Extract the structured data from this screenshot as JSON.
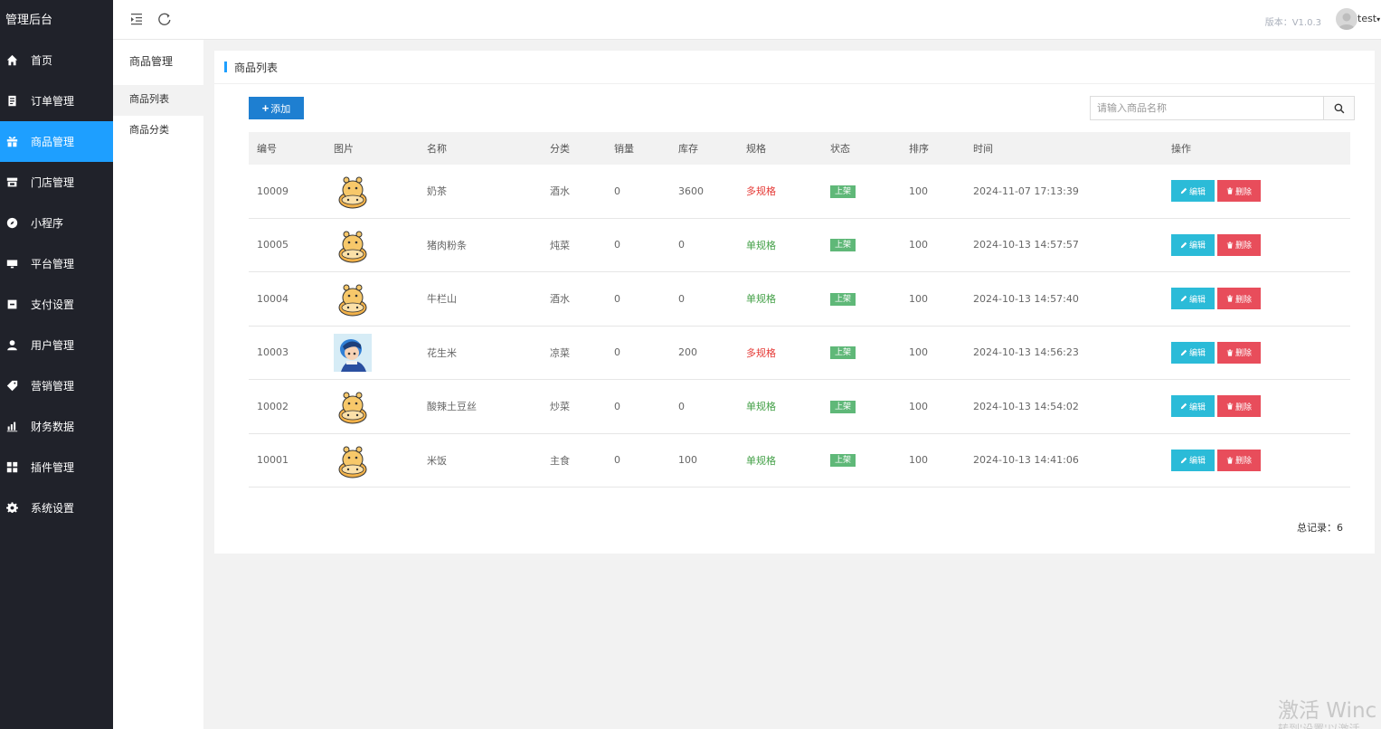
{
  "app": {
    "brand": "管理后台",
    "version": "版本：V1.0.3",
    "username": "test"
  },
  "sidebar": {
    "items": [
      {
        "label": "首页",
        "icon": "home-icon"
      },
      {
        "label": "订单管理",
        "icon": "order-icon"
      },
      {
        "label": "商品管理",
        "icon": "gift-icon",
        "active": true
      },
      {
        "label": "门店管理",
        "icon": "store-icon"
      },
      {
        "label": "小程序",
        "icon": "compass-icon"
      },
      {
        "label": "平台管理",
        "icon": "monitor-icon"
      },
      {
        "label": "支付设置",
        "icon": "wallet-icon"
      },
      {
        "label": "用户管理",
        "icon": "user-icon"
      },
      {
        "label": "营销管理",
        "icon": "tag-icon"
      },
      {
        "label": "财务数据",
        "icon": "bar-chart-icon"
      },
      {
        "label": "插件管理",
        "icon": "plugin-icon"
      },
      {
        "label": "系统设置",
        "icon": "gear-icon"
      }
    ]
  },
  "subnav": {
    "title": "商品管理",
    "items": [
      {
        "label": "商品列表",
        "active": true
      },
      {
        "label": "商品分类"
      }
    ]
  },
  "main": {
    "title": "商品列表",
    "add_label": "添加",
    "search_placeholder": "请输入商品名称",
    "columns": [
      "编号",
      "图片",
      "名称",
      "分类",
      "销量",
      "库存",
      "规格",
      "状态",
      "排序",
      "时间",
      "操作"
    ],
    "rows": [
      {
        "id": "10009",
        "image": "hippo-icon",
        "name": "奶茶",
        "category": "酒水",
        "sales": "0",
        "stock": "3600",
        "spec": "多规格",
        "status": "上架",
        "sort": "100",
        "time": "2024-11-07 17:13:39"
      },
      {
        "id": "10005",
        "image": "hippo-icon",
        "name": "猪肉粉条",
        "category": "炖菜",
        "sales": "0",
        "stock": "0",
        "spec": "单规格",
        "status": "上架",
        "sort": "100",
        "time": "2024-10-13 14:57:57"
      },
      {
        "id": "10004",
        "image": "hippo-icon",
        "name": "牛栏山",
        "category": "酒水",
        "sales": "0",
        "stock": "0",
        "spec": "单规格",
        "status": "上架",
        "sort": "100",
        "time": "2024-10-13 14:57:40"
      },
      {
        "id": "10003",
        "image": "anime-avatar-icon",
        "name": "花生米",
        "category": "凉菜",
        "sales": "0",
        "stock": "200",
        "spec": "多规格",
        "status": "上架",
        "sort": "100",
        "time": "2024-10-13 14:56:23"
      },
      {
        "id": "10002",
        "image": "hippo-icon",
        "name": "酸辣土豆丝",
        "category": "炒菜",
        "sales": "0",
        "stock": "0",
        "spec": "单规格",
        "status": "上架",
        "sort": "100",
        "time": "2024-10-13 14:54:02"
      },
      {
        "id": "10001",
        "image": "hippo-icon",
        "name": "米饭",
        "category": "主食",
        "sales": "0",
        "stock": "100",
        "spec": "单规格",
        "status": "上架",
        "sort": "100",
        "time": "2024-10-13 14:41:06"
      }
    ],
    "edit_label": "编辑",
    "delete_label": "删除",
    "total_text": "总记录：6"
  },
  "watermark": {
    "line1": "激活 Winc",
    "line2": "转到'设置'以激活"
  },
  "colors": {
    "sidebar_bg": "#20222a",
    "accent": "#1e9fff",
    "add_button": "#1e7fd1",
    "multi_spec": "#e53935",
    "single_spec": "#43a047",
    "status_badge": "#5fb878",
    "edit_button": "#2bbbd8",
    "delete_button": "#e84d5b"
  }
}
